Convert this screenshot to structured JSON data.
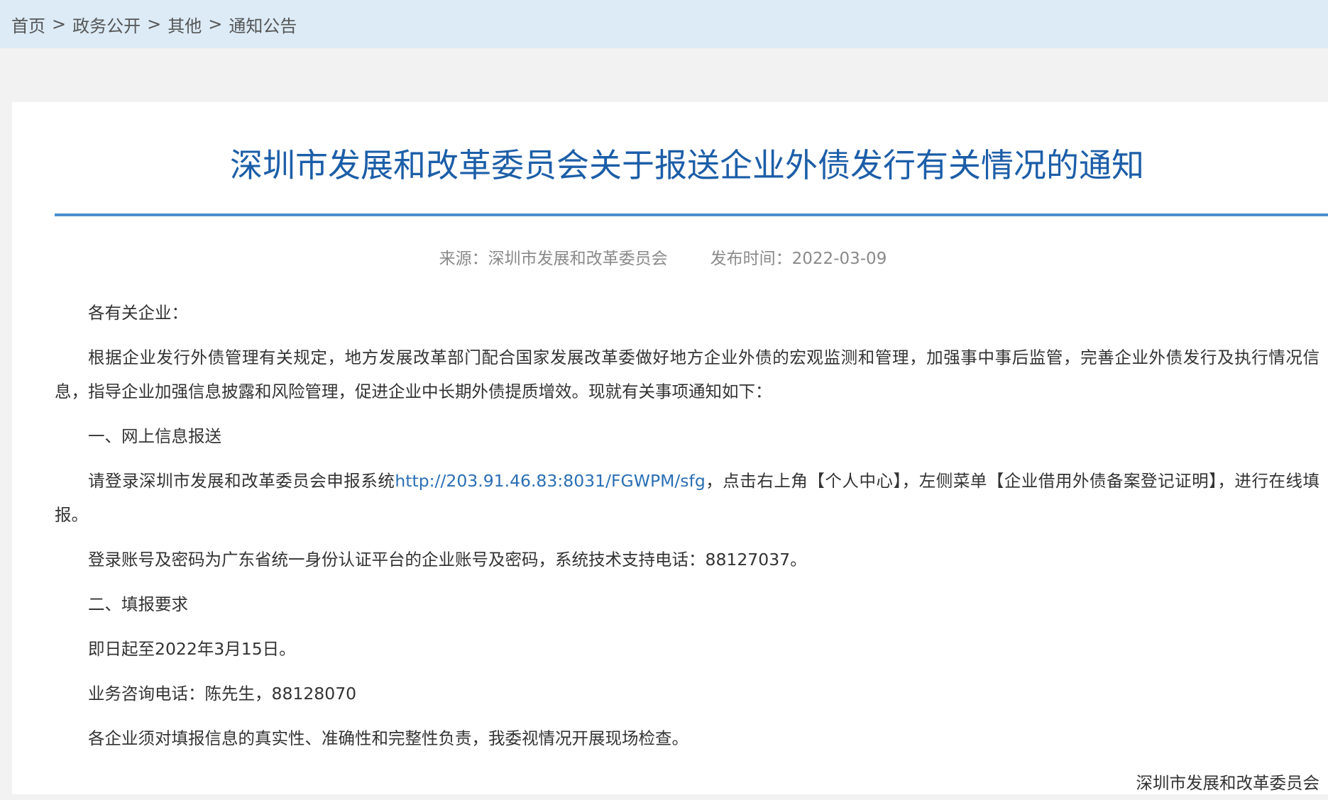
{
  "breadcrumb": {
    "items": [
      "首页",
      "政务公开",
      "其他",
      "通知公告"
    ],
    "separator": ">"
  },
  "article": {
    "title": "深圳市发展和改革委员会关于报送企业外债发行有关情况的通知",
    "source": "来源：深圳市发展和改革委员会",
    "publish_time": "发布时间：2022-03-09",
    "greeting": "各有关企业：",
    "paragraphs": {
      "intro": "根据企业发行外债管理有关规定，地方发展改革部门配合国家发展改革委做好地方企业外债的宏观监测和管理，加强事中事后监管，完善企业外债发行及执行情况信息，指导企业加强信息披露和风险管理，促进企业中长期外债提质增效。现就有关事项通知如下：",
      "section1_heading": "一、网上信息报送",
      "section1_text_before": "请登录深圳市发展和改革委员会申报系统",
      "section1_link": "http://203.91.46.83:8031/FGWPM/sfg",
      "section1_text_after": "，点击右上角【个人中心】，左侧菜单【企业借用外债备案登记证明】，进行在线填报。",
      "section1_login": "登录账号及密码为广东省统一身份认证平台的企业账号及密码，系统技术支持电话：88127037。",
      "section2_heading": "二、填报要求",
      "section2_deadline": "即日起至2022年3月15日。",
      "section2_contact": "业务咨询电话：陈先生，88128070",
      "section2_responsibility": "各企业须对填报信息的真实性、准确性和完整性负责，我委视情况开展现场检查。"
    },
    "signature": "深圳市发展和改革委员会"
  },
  "colors": {
    "breadcrumb_bg": "#dcebf6",
    "title": "#1c5ea8",
    "rule": "#4a8fce",
    "link": "#2a6fb4",
    "meta": "#8a8a8a",
    "page_bg": "#f2f2f2"
  }
}
